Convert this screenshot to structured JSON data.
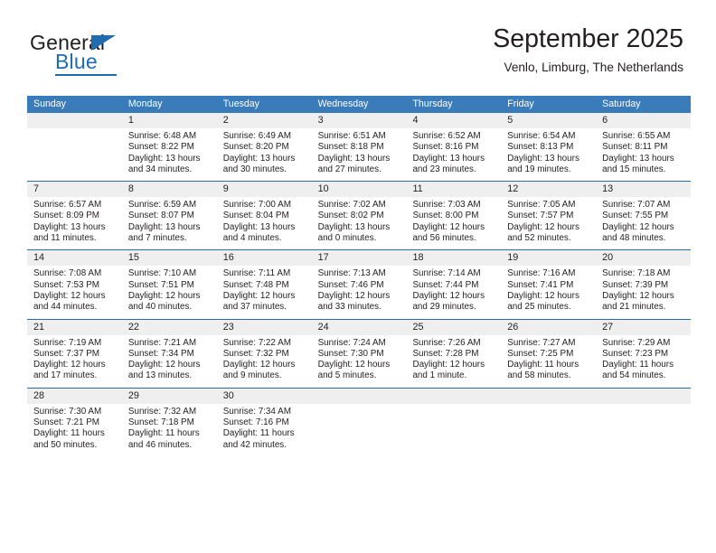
{
  "brand": {
    "name_part1": "General",
    "name_part2": "Blue",
    "accent_color": "#1f6cb0"
  },
  "header": {
    "title": "September 2025",
    "location": "Venlo, Limburg, The Netherlands"
  },
  "theme": {
    "header_row_bg": "#3a7cba",
    "daynum_band_bg": "#efefef",
    "week_divider": "#2d6ca6",
    "text": "#231f20"
  },
  "weekdays": [
    "Sunday",
    "Monday",
    "Tuesday",
    "Wednesday",
    "Thursday",
    "Friday",
    "Saturday"
  ],
  "weeks": [
    {
      "days": [
        {
          "num": "",
          "lines": [
            "",
            "",
            "",
            ""
          ]
        },
        {
          "num": "1",
          "lines": [
            "Sunrise: 6:48 AM",
            "Sunset: 8:22 PM",
            "Daylight: 13 hours",
            "and 34 minutes."
          ]
        },
        {
          "num": "2",
          "lines": [
            "Sunrise: 6:49 AM",
            "Sunset: 8:20 PM",
            "Daylight: 13 hours",
            "and 30 minutes."
          ]
        },
        {
          "num": "3",
          "lines": [
            "Sunrise: 6:51 AM",
            "Sunset: 8:18 PM",
            "Daylight: 13 hours",
            "and 27 minutes."
          ]
        },
        {
          "num": "4",
          "lines": [
            "Sunrise: 6:52 AM",
            "Sunset: 8:16 PM",
            "Daylight: 13 hours",
            "and 23 minutes."
          ]
        },
        {
          "num": "5",
          "lines": [
            "Sunrise: 6:54 AM",
            "Sunset: 8:13 PM",
            "Daylight: 13 hours",
            "and 19 minutes."
          ]
        },
        {
          "num": "6",
          "lines": [
            "Sunrise: 6:55 AM",
            "Sunset: 8:11 PM",
            "Daylight: 13 hours",
            "and 15 minutes."
          ]
        }
      ]
    },
    {
      "days": [
        {
          "num": "7",
          "lines": [
            "Sunrise: 6:57 AM",
            "Sunset: 8:09 PM",
            "Daylight: 13 hours",
            "and 11 minutes."
          ]
        },
        {
          "num": "8",
          "lines": [
            "Sunrise: 6:59 AM",
            "Sunset: 8:07 PM",
            "Daylight: 13 hours",
            "and 7 minutes."
          ]
        },
        {
          "num": "9",
          "lines": [
            "Sunrise: 7:00 AM",
            "Sunset: 8:04 PM",
            "Daylight: 13 hours",
            "and 4 minutes."
          ]
        },
        {
          "num": "10",
          "lines": [
            "Sunrise: 7:02 AM",
            "Sunset: 8:02 PM",
            "Daylight: 13 hours",
            "and 0 minutes."
          ]
        },
        {
          "num": "11",
          "lines": [
            "Sunrise: 7:03 AM",
            "Sunset: 8:00 PM",
            "Daylight: 12 hours",
            "and 56 minutes."
          ]
        },
        {
          "num": "12",
          "lines": [
            "Sunrise: 7:05 AM",
            "Sunset: 7:57 PM",
            "Daylight: 12 hours",
            "and 52 minutes."
          ]
        },
        {
          "num": "13",
          "lines": [
            "Sunrise: 7:07 AM",
            "Sunset: 7:55 PM",
            "Daylight: 12 hours",
            "and 48 minutes."
          ]
        }
      ]
    },
    {
      "days": [
        {
          "num": "14",
          "lines": [
            "Sunrise: 7:08 AM",
            "Sunset: 7:53 PM",
            "Daylight: 12 hours",
            "and 44 minutes."
          ]
        },
        {
          "num": "15",
          "lines": [
            "Sunrise: 7:10 AM",
            "Sunset: 7:51 PM",
            "Daylight: 12 hours",
            "and 40 minutes."
          ]
        },
        {
          "num": "16",
          "lines": [
            "Sunrise: 7:11 AM",
            "Sunset: 7:48 PM",
            "Daylight: 12 hours",
            "and 37 minutes."
          ]
        },
        {
          "num": "17",
          "lines": [
            "Sunrise: 7:13 AM",
            "Sunset: 7:46 PM",
            "Daylight: 12 hours",
            "and 33 minutes."
          ]
        },
        {
          "num": "18",
          "lines": [
            "Sunrise: 7:14 AM",
            "Sunset: 7:44 PM",
            "Daylight: 12 hours",
            "and 29 minutes."
          ]
        },
        {
          "num": "19",
          "lines": [
            "Sunrise: 7:16 AM",
            "Sunset: 7:41 PM",
            "Daylight: 12 hours",
            "and 25 minutes."
          ]
        },
        {
          "num": "20",
          "lines": [
            "Sunrise: 7:18 AM",
            "Sunset: 7:39 PM",
            "Daylight: 12 hours",
            "and 21 minutes."
          ]
        }
      ]
    },
    {
      "days": [
        {
          "num": "21",
          "lines": [
            "Sunrise: 7:19 AM",
            "Sunset: 7:37 PM",
            "Daylight: 12 hours",
            "and 17 minutes."
          ]
        },
        {
          "num": "22",
          "lines": [
            "Sunrise: 7:21 AM",
            "Sunset: 7:34 PM",
            "Daylight: 12 hours",
            "and 13 minutes."
          ]
        },
        {
          "num": "23",
          "lines": [
            "Sunrise: 7:22 AM",
            "Sunset: 7:32 PM",
            "Daylight: 12 hours",
            "and 9 minutes."
          ]
        },
        {
          "num": "24",
          "lines": [
            "Sunrise: 7:24 AM",
            "Sunset: 7:30 PM",
            "Daylight: 12 hours",
            "and 5 minutes."
          ]
        },
        {
          "num": "25",
          "lines": [
            "Sunrise: 7:26 AM",
            "Sunset: 7:28 PM",
            "Daylight: 12 hours",
            "and 1 minute."
          ]
        },
        {
          "num": "26",
          "lines": [
            "Sunrise: 7:27 AM",
            "Sunset: 7:25 PM",
            "Daylight: 11 hours",
            "and 58 minutes."
          ]
        },
        {
          "num": "27",
          "lines": [
            "Sunrise: 7:29 AM",
            "Sunset: 7:23 PM",
            "Daylight: 11 hours",
            "and 54 minutes."
          ]
        }
      ]
    },
    {
      "days": [
        {
          "num": "28",
          "lines": [
            "Sunrise: 7:30 AM",
            "Sunset: 7:21 PM",
            "Daylight: 11 hours",
            "and 50 minutes."
          ]
        },
        {
          "num": "29",
          "lines": [
            "Sunrise: 7:32 AM",
            "Sunset: 7:18 PM",
            "Daylight: 11 hours",
            "and 46 minutes."
          ]
        },
        {
          "num": "30",
          "lines": [
            "Sunrise: 7:34 AM",
            "Sunset: 7:16 PM",
            "Daylight: 11 hours",
            "and 42 minutes."
          ]
        },
        {
          "num": "",
          "lines": [
            "",
            "",
            "",
            ""
          ]
        },
        {
          "num": "",
          "lines": [
            "",
            "",
            "",
            ""
          ]
        },
        {
          "num": "",
          "lines": [
            "",
            "",
            "",
            ""
          ]
        },
        {
          "num": "",
          "lines": [
            "",
            "",
            "",
            ""
          ]
        }
      ]
    }
  ]
}
